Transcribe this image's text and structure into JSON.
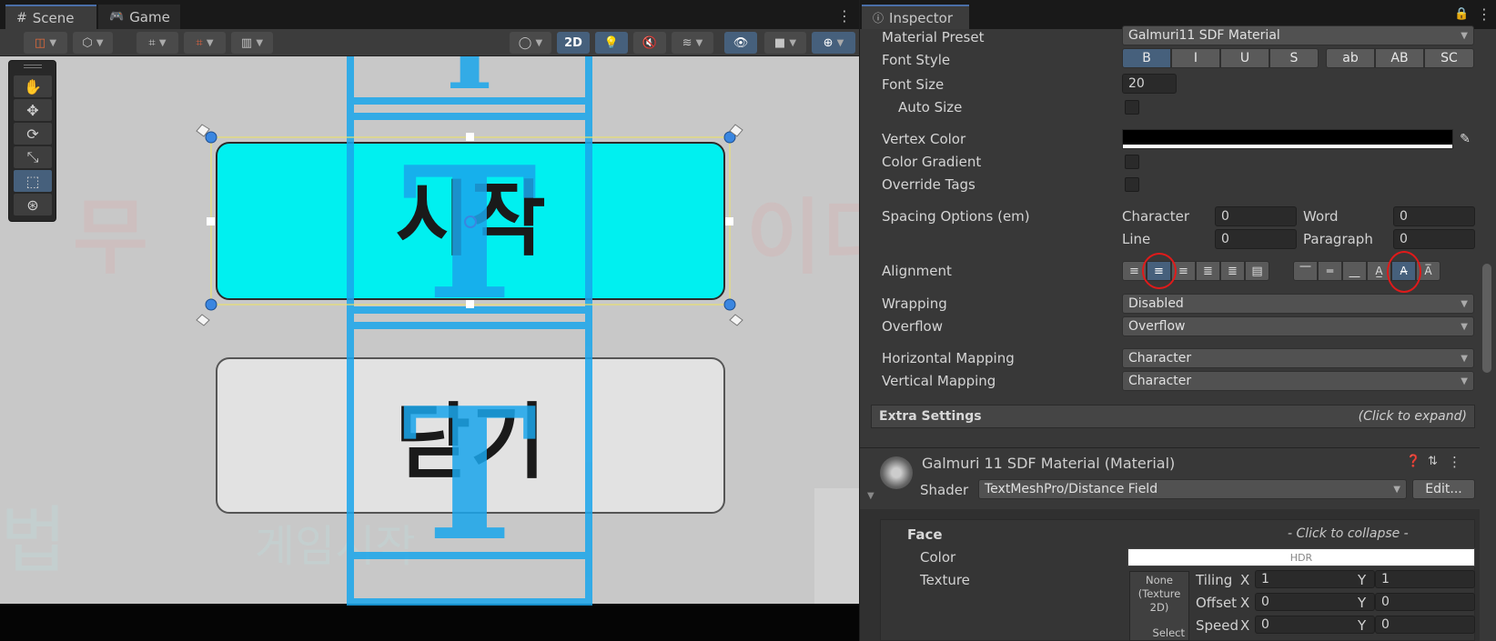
{
  "scene_tabs": {
    "scene": "Scene",
    "game": "Game"
  },
  "scene_toolbar": {
    "mode_2d": "2D"
  },
  "viewport": {
    "button1_text": "시작",
    "button2_text": "닫기",
    "bg_left_text": "무",
    "bg_right_text": "이디",
    "bg_bottom_left_text": "법",
    "bg_bottom_mid_text": "게임시작",
    "button1_color": "#00f0f0",
    "button2_color": "#e2e2e2",
    "gizmo_color": "#1aa6ec"
  },
  "inspector": {
    "tab_title": "Inspector",
    "material_preset": {
      "label": "Material Preset",
      "value": "Galmuri11 SDF Material"
    },
    "font_style": {
      "label": "Font Style",
      "buttons": [
        "B",
        "I",
        "U",
        "S",
        "ab",
        "AB",
        "SC"
      ]
    },
    "font_size": {
      "label": "Font Size",
      "value": "20"
    },
    "auto_size": {
      "label": "Auto Size"
    },
    "vertex_color": {
      "label": "Vertex Color"
    },
    "color_gradient": {
      "label": "Color Gradient"
    },
    "override_tags": {
      "label": "Override Tags"
    },
    "spacing": {
      "label": "Spacing Options (em)",
      "character_label": "Character",
      "character_value": "0",
      "word_label": "Word",
      "word_value": "0",
      "line_label": "Line",
      "line_value": "0",
      "paragraph_label": "Paragraph",
      "paragraph_value": "0"
    },
    "alignment": {
      "label": "Alignment"
    },
    "wrapping": {
      "label": "Wrapping",
      "value": "Disabled"
    },
    "overflow": {
      "label": "Overflow",
      "value": "Overflow"
    },
    "horizontal_mapping": {
      "label": "Horizontal Mapping",
      "value": "Character"
    },
    "vertical_mapping": {
      "label": "Vertical Mapping",
      "value": "Character"
    },
    "extra_settings": {
      "label": "Extra Settings",
      "hint": "(Click to expand)"
    },
    "material": {
      "name": "Galmuri 11 SDF Material (Material)",
      "shader_label": "Shader",
      "shader_value": "TextMeshPro/Distance Field",
      "edit_button": "Edit..."
    },
    "face": {
      "label": "Face",
      "hint": "- Click to collapse -",
      "color_label": "Color",
      "color_value": "HDR",
      "texture_label": "Texture",
      "texture_slot": "None (Texture 2D)",
      "select": "Select",
      "tiling_label": "Tiling",
      "offset_label": "Offset",
      "speed_label": "Speed",
      "x_label": "X",
      "y_label": "Y",
      "tiling_x": "1",
      "tiling_y": "1",
      "offset_x": "0",
      "offset_y": "0",
      "speed_x": "0",
      "speed_y": "0"
    }
  }
}
